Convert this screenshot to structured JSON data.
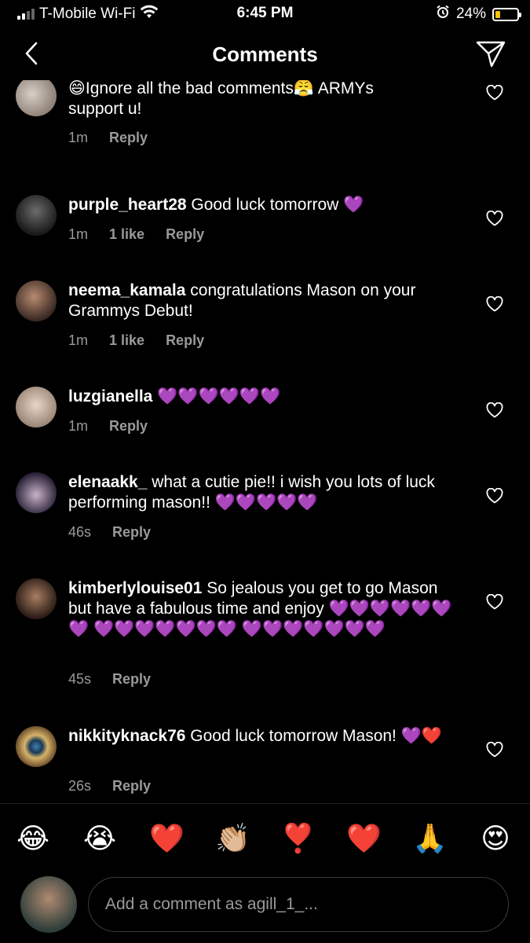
{
  "status": {
    "carrier": "T-Mobile Wi-Fi",
    "time": "6:45 PM",
    "battery": "24%",
    "battery_level": 0.24
  },
  "header": {
    "title": "Comments"
  },
  "comments": [
    {
      "username": "",
      "text": "",
      "partial_line1": "😄Ignore all the bad comments😤 ARMYs",
      "partial_line2": "support u!",
      "time": "1m",
      "likes": "",
      "reply": "Reply"
    },
    {
      "username": "purple_heart28",
      "text": "Good luck tomorrow 💜",
      "time": "1m",
      "likes": "1 like",
      "reply": "Reply"
    },
    {
      "username": "neema_kamala",
      "text": "congratulations Mason on your Grammys Debut!",
      "time": "1m",
      "likes": "1 like",
      "reply": "Reply"
    },
    {
      "username": "luzgianella",
      "text": "💜💜💜💜💜💜",
      "time": "1m",
      "likes": "",
      "reply": "Reply"
    },
    {
      "username": "elenaakk_",
      "text": "what a cutie pie!! i wish you lots of luck performing mason!! 💜💜💜💜💜",
      "time": "46s",
      "likes": "",
      "reply": "Reply"
    },
    {
      "username": "kimberlylouise01",
      "text": "So jealous you get to go Mason but have a fabulous time and enjoy 💜💜💜💜💜💜💜 💜💜💜💜💜💜💜 💜💜💜💜💜💜💜",
      "time": "45s",
      "likes": "",
      "reply": "Reply"
    },
    {
      "username": "nikkityknack76",
      "text": "Good luck tomorrow Mason! 💜❤️",
      "time": "26s",
      "likes": "",
      "reply": "Reply"
    }
  ],
  "emoji_bar": [
    "😂",
    "😭",
    "❤️",
    "👏🏼",
    "❣️",
    "❤️",
    "🙏",
    "😍"
  ],
  "composer": {
    "placeholder": "Add a comment as agill_1_..."
  },
  "colors": {
    "background": "#000000",
    "secondary_text": "#9a9a9a",
    "battery_fill": "#f5c400"
  }
}
